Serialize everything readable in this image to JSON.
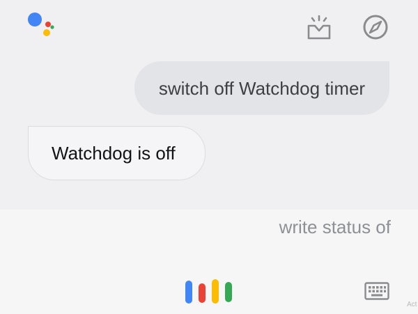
{
  "header": {
    "logo_icon": "google-assistant-logo",
    "snapshot_icon": "snapshot-tray-icon",
    "explore_icon": "compass-explore-icon"
  },
  "conversation": {
    "user_message": "switch off Watchdog timer",
    "assistant_reply": "Watchdog is off"
  },
  "input": {
    "partial_query": "write status of",
    "mic_icon": "google-mic-bars-icon",
    "keyboard_icon": "keyboard-icon"
  },
  "watermark": "Act",
  "colors": {
    "blue": "#4285f4",
    "red": "#ea4335",
    "yellow": "#fbbc05",
    "green": "#34a853",
    "icon_gray": "#8a8b8f"
  }
}
